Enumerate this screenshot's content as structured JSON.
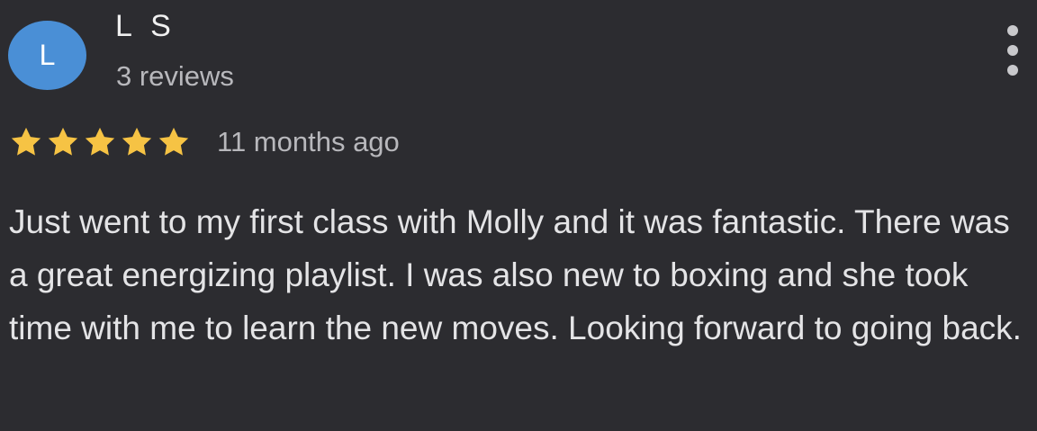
{
  "review": {
    "avatar_letter": "L",
    "avatar_color": "#4a8fd6",
    "author_name": "L S",
    "review_count": "3 reviews",
    "rating": 5,
    "rating_max": 5,
    "star_color": "#f6c344",
    "date": "11 months ago",
    "menu_icon": "more-vertical-icon",
    "text": "Just went to my first class with Molly and it was fantastic. There was a great energizing playlist. I was also new to boxing and she took time with me to learn the new moves. Looking forward to going back."
  }
}
